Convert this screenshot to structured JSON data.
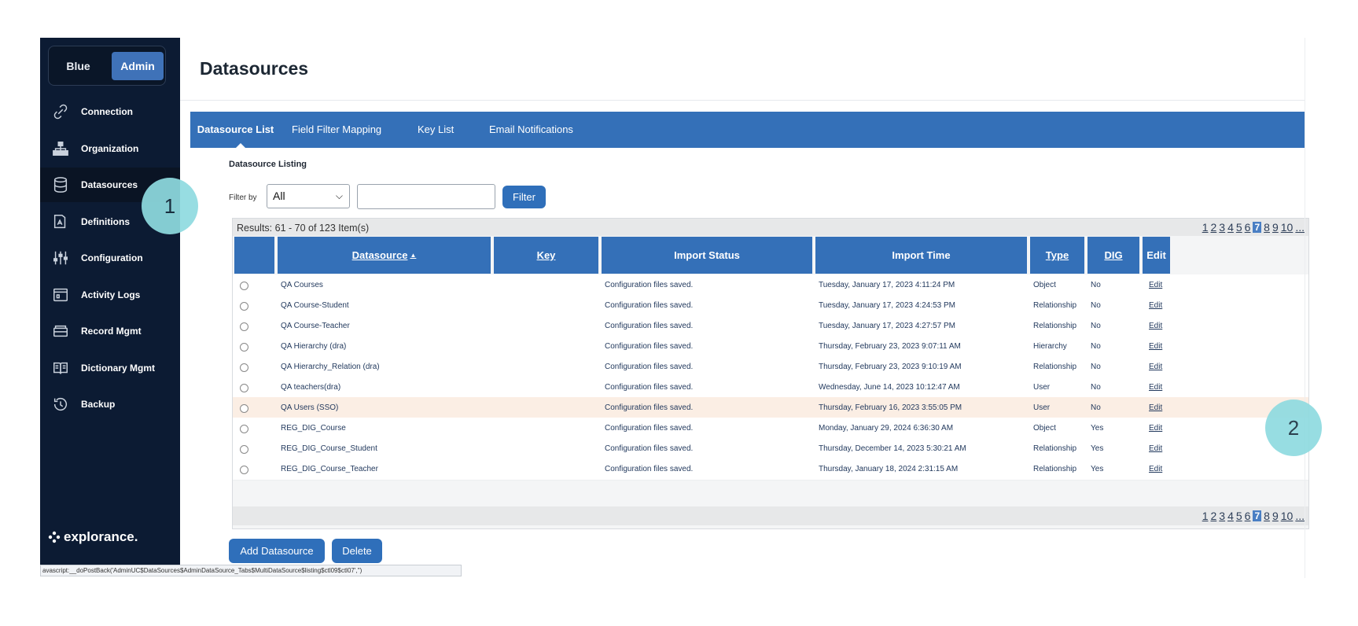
{
  "mode_switch": {
    "blue": "Blue",
    "admin": "Admin"
  },
  "sidebar": {
    "items": [
      {
        "label": "Connection",
        "icon": "link-icon"
      },
      {
        "label": "Organization",
        "icon": "org-chart-icon"
      },
      {
        "label": "Datasources",
        "icon": "database-icon"
      },
      {
        "label": "Definitions",
        "icon": "definitions-icon"
      },
      {
        "label": "Configuration",
        "icon": "sliders-icon"
      },
      {
        "label": "Activity Logs",
        "icon": "log-icon"
      },
      {
        "label": "Record Mgmt",
        "icon": "archive-box-icon"
      },
      {
        "label": "Dictionary Mgmt",
        "icon": "book-icon"
      },
      {
        "label": "Backup",
        "icon": "history-icon"
      }
    ],
    "active": "Datasources",
    "logo": "explorance."
  },
  "page": {
    "title": "Datasources"
  },
  "tabs": [
    "Datasource List",
    "Field Filter Mapping",
    "Key List",
    "Email Notifications"
  ],
  "listing": {
    "title": "Datasource Listing",
    "filter_label": "Filter by",
    "filter_value": "All",
    "filter_button": "Filter",
    "results": "Results: 61 - 70 of 123 Item(s)",
    "pages": [
      "1",
      "2",
      "3",
      "4",
      "5",
      "6",
      "7",
      "8",
      "9",
      "10",
      "..."
    ],
    "current_page": "7"
  },
  "table": {
    "headers": {
      "datasource": "Datasource",
      "sort_indicator": "▲",
      "key": "Key",
      "import_status": "Import Status",
      "import_time": "Import Time",
      "type": "Type",
      "dig": "DIG",
      "edit": "Edit"
    },
    "rows": [
      {
        "datasource": "QA Courses",
        "key": "",
        "status": "Configuration files saved.",
        "time": "Tuesday, January 17, 2023 4:11:24 PM",
        "type": "Object",
        "dig": "No",
        "edit": "Edit"
      },
      {
        "datasource": "QA Course-Student",
        "key": "",
        "status": "Configuration files saved.",
        "time": "Tuesday, January 17, 2023 4:24:53 PM",
        "type": "Relationship",
        "dig": "No",
        "edit": "Edit"
      },
      {
        "datasource": "QA Course-Teacher",
        "key": "",
        "status": "Configuration files saved.",
        "time": "Tuesday, January 17, 2023 4:27:57 PM",
        "type": "Relationship",
        "dig": "No",
        "edit": "Edit"
      },
      {
        "datasource": "QA Hierarchy (dra)",
        "key": "",
        "status": "Configuration files saved.",
        "time": "Thursday, February 23, 2023 9:07:11 AM",
        "type": "Hierarchy",
        "dig": "No",
        "edit": "Edit"
      },
      {
        "datasource": "QA Hierarchy_Relation (dra)",
        "key": "",
        "status": "Configuration files saved.",
        "time": "Thursday, February 23, 2023 9:10:19 AM",
        "type": "Relationship",
        "dig": "No",
        "edit": "Edit"
      },
      {
        "datasource": "QA teachers(dra)",
        "key": "",
        "status": "Configuration files saved.",
        "time": "Wednesday, June 14, 2023 10:12:47 AM",
        "type": "User",
        "dig": "No",
        "edit": "Edit"
      },
      {
        "datasource": "QA Users (SSO)",
        "key": "",
        "status": "Configuration files saved.",
        "time": "Thursday, February 16, 2023 3:55:05 PM",
        "type": "User",
        "dig": "No",
        "edit": "Edit"
      },
      {
        "datasource": "REG_DIG_Course",
        "key": "",
        "status": "Configuration files saved.",
        "time": "Monday, January 29, 2024 6:36:30 AM",
        "type": "Object",
        "dig": "Yes",
        "edit": "Edit"
      },
      {
        "datasource": "REG_DIG_Course_Student",
        "key": "",
        "status": "Configuration files saved.",
        "time": "Thursday, December 14, 2023 5:30:21 AM",
        "type": "Relationship",
        "dig": "Yes",
        "edit": "Edit"
      },
      {
        "datasource": "REG_DIG_Course_Teacher",
        "key": "",
        "status": "Configuration files saved.",
        "time": "Thursday, January 18, 2024 2:31:15 AM",
        "type": "Relationship",
        "dig": "Yes",
        "edit": "Edit"
      }
    ],
    "highlighted_row": 6
  },
  "buttons": {
    "add": "Add Datasource",
    "delete": "Delete"
  },
  "status_bar": "avascript:__doPostBack('AdminUC$DataSources$AdminDataSource_Tabs$MultiDataSource$listing$ctl09$ctl07','')",
  "callouts": [
    "1",
    "2"
  ],
  "colors": {
    "sidebar": "#0c1b33",
    "accent": "#3470b8",
    "highlight_row": "#fbeee4",
    "callout": "#8fdbe0"
  }
}
